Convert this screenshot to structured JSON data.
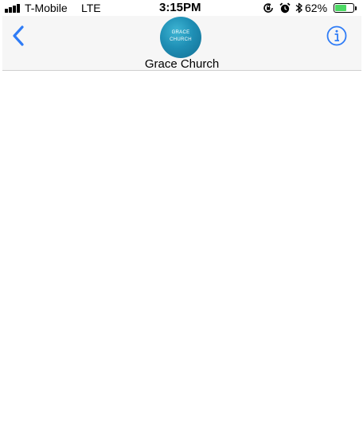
{
  "status_bar": {
    "carrier": "T-Mobile",
    "network": "LTE",
    "time": "3:15PM",
    "battery_percent": "62%",
    "battery_level": 0.62,
    "icons": [
      "signal-bars-icon",
      "orientation-lock-icon",
      "alarm-icon",
      "bluetooth-icon",
      "battery-icon"
    ]
  },
  "header": {
    "contact_name": "Grace Church",
    "avatar_text": [
      "GRACE",
      "CHURCH"
    ],
    "back_icon": "chevron-left-icon",
    "info_icon": "info-icon"
  },
  "colors": {
    "accent": "#2f7cf6",
    "battery_fill": "#4cd964",
    "header_bg": "#f6f6f6",
    "avatar": "#1f8fb5"
  }
}
